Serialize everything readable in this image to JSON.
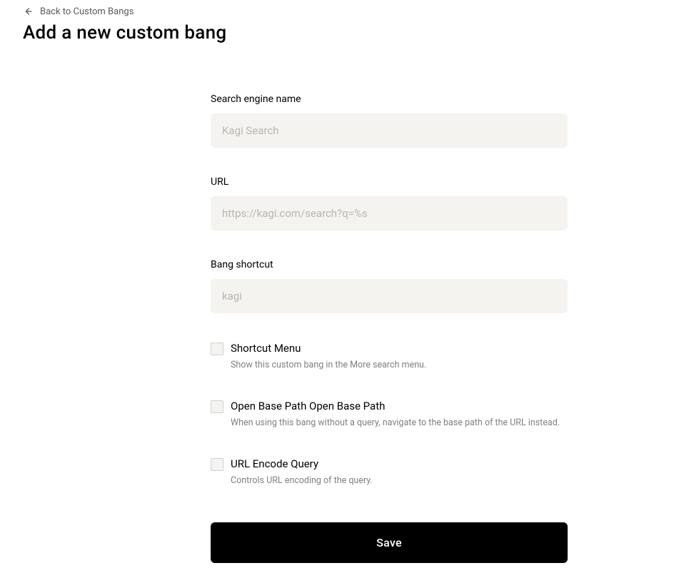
{
  "header": {
    "back_label": "Back to Custom Bangs",
    "title": "Add a new custom bang"
  },
  "form": {
    "search_engine": {
      "label": "Search engine name",
      "placeholder": "Kagi Search",
      "value": ""
    },
    "url": {
      "label": "URL",
      "placeholder": "https://kagi.com/search?q=%s",
      "value": ""
    },
    "bang_shortcut": {
      "label": "Bang shortcut",
      "placeholder": "kagi",
      "value": ""
    },
    "shortcut_menu": {
      "label": "Shortcut Menu",
      "description": "Show this custom bang in the More search menu.",
      "checked": false
    },
    "open_base_path": {
      "label": "Open Base Path Open Base Path",
      "description": "When using this bang without a query, navigate to the base path of the URL instead.",
      "checked": false
    },
    "url_encode": {
      "label": "URL Encode Query",
      "description": "Controls URL encoding of the query.",
      "checked": false
    },
    "save_label": "Save"
  }
}
